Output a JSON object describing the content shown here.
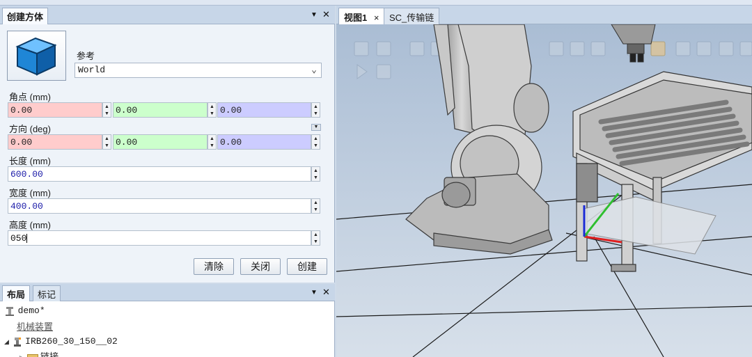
{
  "create_panel": {
    "title": "创建方体",
    "reference_label": "参考",
    "reference_value": "World",
    "corner": {
      "label": "角点 (mm)",
      "x": "0.00",
      "y": "0.00",
      "z": "0.00"
    },
    "orientation": {
      "label": "方向 (deg)",
      "x": "0.00",
      "y": "0.00",
      "z": "0.00"
    },
    "length": {
      "label": "长度 (mm)",
      "value": "600.00"
    },
    "width": {
      "label": "宽度 (mm)",
      "value": "400.00"
    },
    "height": {
      "label": "高度 (mm)",
      "value": "050"
    },
    "buttons": {
      "clear": "清除",
      "close": "关闭",
      "create": "创建"
    }
  },
  "layout_panel": {
    "tabs": [
      "布局",
      "标记"
    ],
    "tree": [
      "demo*",
      "机械装置",
      "IRB260_30_150__02",
      "链接"
    ]
  },
  "viewport": {
    "tabs": [
      "视图1",
      "SC_传输链"
    ]
  },
  "header_buttons": {
    "pin": "▼",
    "close": "✕"
  },
  "colors": {
    "x_axis": "#ffcccc",
    "y_axis": "#ccffcc",
    "z_axis": "#ccccff",
    "panel_header": "#c7d6e8"
  }
}
